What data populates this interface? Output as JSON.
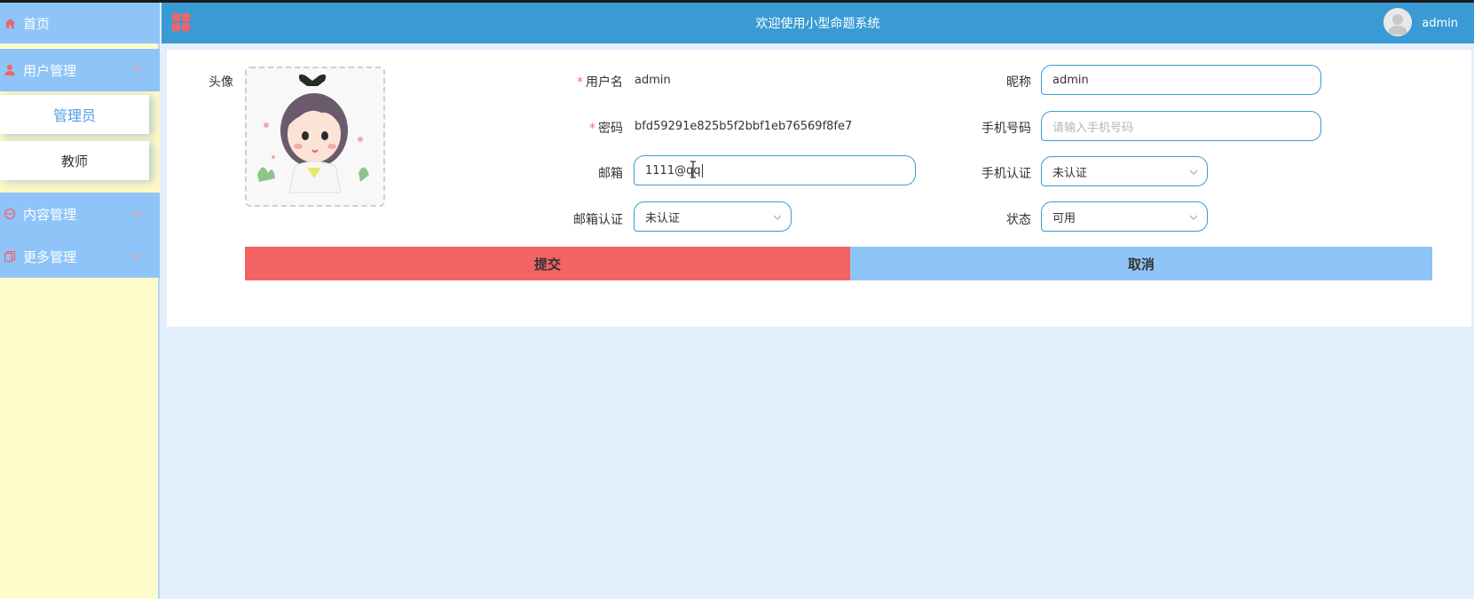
{
  "sidebar": {
    "home_label": "首页",
    "items": [
      {
        "label": "用户管理",
        "expanded": true
      },
      {
        "label": "内容管理",
        "expanded": false
      },
      {
        "label": "更多管理",
        "expanded": false
      }
    ],
    "sub_items": [
      {
        "label": "管理员",
        "active": true
      },
      {
        "label": "教师",
        "active": false
      }
    ]
  },
  "header": {
    "title": "欢迎使用小型命题系统",
    "username": "admin"
  },
  "form": {
    "avatar_label": "头像",
    "username_label": "用户名",
    "username_value": "admin",
    "password_label": "密码",
    "password_value": "bfd59291e825b5f2bbf1eb76569f8fe7",
    "email_label": "邮箱",
    "email_value": "1111@qq",
    "email_verify_label": "邮箱认证",
    "email_verify_value": "未认证",
    "nickname_label": "昵称",
    "nickname_value": "admin",
    "phone_label": "手机号码",
    "phone_placeholder": "请输入手机号码",
    "phone_verify_label": "手机认证",
    "phone_verify_value": "未认证",
    "status_label": "状态",
    "status_value": "可用",
    "required_mark": "*"
  },
  "buttons": {
    "submit": "提交",
    "cancel": "取消"
  },
  "colors": {
    "header_bg": "#3a9bd4",
    "sidebar_menu_bg": "#8ec4f8",
    "sidebar_bg": "#fffccc",
    "submit_bg": "#f26364",
    "cancel_bg": "#8ec4f8",
    "page_bg": "#e2effc"
  }
}
